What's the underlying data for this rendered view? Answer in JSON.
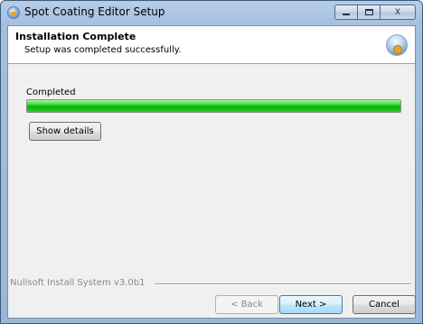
{
  "window": {
    "title": "Spot Coating Editor Setup",
    "close_glyph": "X"
  },
  "header": {
    "title": "Installation Complete",
    "subtitle": "Setup was completed successfully."
  },
  "progress": {
    "label": "Completed",
    "percent": 100,
    "color": "#06b006"
  },
  "buttons": {
    "show_details": "Show details",
    "back": "< Back",
    "next": "Next >",
    "cancel": "Cancel"
  },
  "footer": {
    "branding": "Nullsoft Install System v3.0b1"
  },
  "icons": {
    "app": "installer-app-icon",
    "header": "installer-logo-icon"
  }
}
